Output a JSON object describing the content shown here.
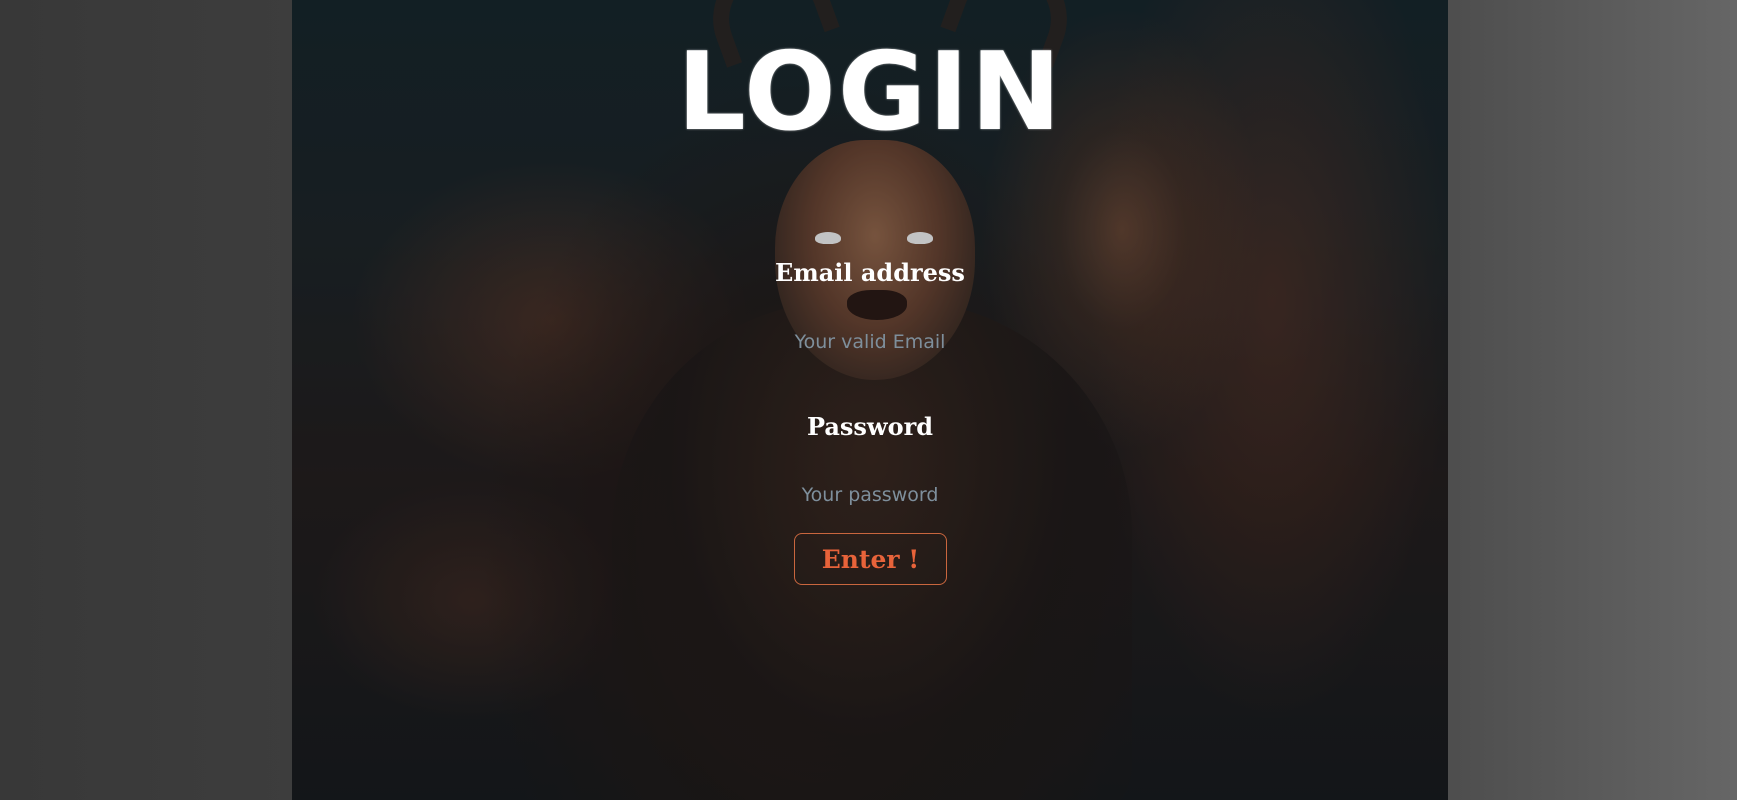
{
  "page": {
    "title": "LOGIN"
  },
  "form": {
    "email_label": "Email address",
    "email_placeholder": "Your valid Email",
    "email_value": "",
    "password_label": "Password",
    "password_placeholder": "Your password",
    "password_value": "",
    "submit_label": "Enter !"
  },
  "colors": {
    "accent": "#e8633a",
    "text": "#ffffff",
    "placeholder": "#7e8f9c",
    "side_background": "#3d3d3d"
  }
}
